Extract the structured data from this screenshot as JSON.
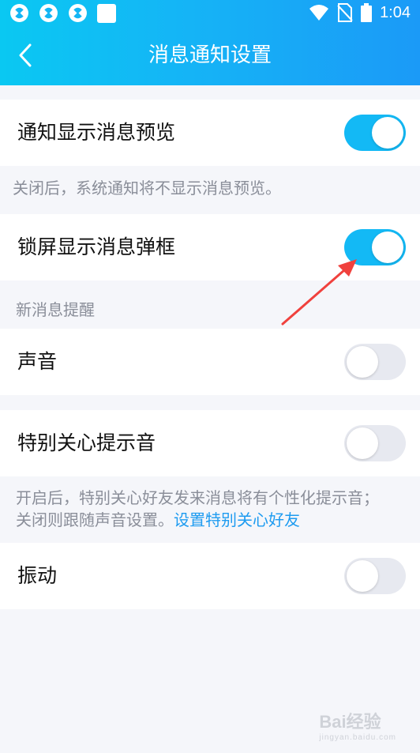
{
  "status_bar": {
    "time": "1:04",
    "icons": [
      "app-icon",
      "app-icon",
      "app-icon",
      "square-icon",
      "wifi-icon",
      "no-sim-icon",
      "battery-icon"
    ]
  },
  "header": {
    "title": "消息通知设置",
    "back_icon": "chevron-left-icon"
  },
  "settings": {
    "preview": {
      "label": "通知显示消息预览",
      "enabled": true
    },
    "preview_note": "关闭后，系统通知将不显示消息预览。",
    "lockscreen": {
      "label": "锁屏显示消息弹框",
      "enabled": true
    },
    "new_msg_section": "新消息提醒",
    "sound": {
      "label": "声音",
      "enabled": false
    },
    "special": {
      "label": "特别关心提示音",
      "enabled": false
    },
    "special_note_line1": "开启后，特别关心好友发来消息将有个性化提示音；",
    "special_note_line2": "关闭则跟随声音设置。",
    "special_note_link": "设置特别关心好友",
    "vibrate": {
      "label": "振动",
      "enabled": false
    }
  },
  "colors": {
    "accent": "#13b9f5",
    "toggle_off": "#e7e9f0",
    "annotation_arrow": "#f0413d"
  },
  "watermark": {
    "text": "Bai经验",
    "url": "jingyan.baidu.com"
  }
}
